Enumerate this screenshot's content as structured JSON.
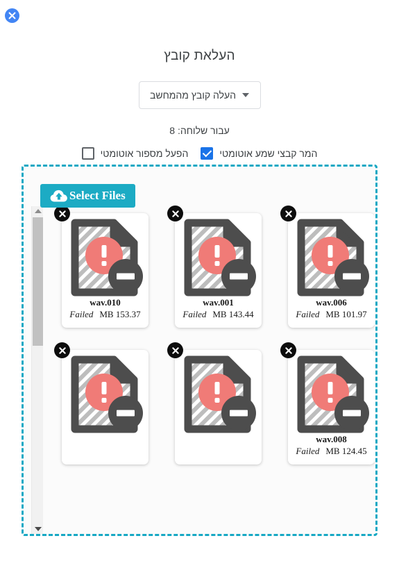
{
  "close_button": {
    "icon": "close-icon",
    "color": "#4285f4"
  },
  "header": {
    "title": "העלאת קובץ",
    "source_dropdown": {
      "label": "העלה קובץ מהמחשב",
      "caret_icon": "chevron-down-icon"
    },
    "board_line": "עבור שלוחה: 8"
  },
  "options": [
    {
      "label": "הפעל מספור אוטומטי",
      "checked": false
    },
    {
      "label": "המר קבצי שמע אוטומטי",
      "checked": true
    }
  ],
  "dropzone": {
    "select_files_label": "Select Files",
    "select_files_icon": "cloud-upload-icon",
    "border_color": "#17a8c4",
    "button_color": "#1cabc4",
    "scrollbar": {
      "up_arrow_icon": "triangle-up-icon",
      "down_arrow_icon": "triangle-down-icon"
    },
    "files": [
      {
        "name": "wav.006",
        "status": "Failed",
        "size": "MB 101.97",
        "icon": "file-error-icon",
        "remove_icon": "close-icon"
      },
      {
        "name": "wav.001",
        "status": "Failed",
        "size": "MB 143.44",
        "icon": "file-error-icon",
        "remove_icon": "close-icon"
      },
      {
        "name": "wav.010",
        "status": "Failed",
        "size": "MB 153.37",
        "icon": "file-error-icon",
        "remove_icon": "close-icon"
      },
      {
        "name": "wav.008",
        "status": "Failed",
        "size": "MB 124.45",
        "icon": "file-error-icon",
        "remove_icon": "close-icon"
      },
      {
        "name": "",
        "status": "",
        "size": "",
        "icon": "file-error-icon",
        "remove_icon": "close-icon"
      },
      {
        "name": "",
        "status": "",
        "size": "",
        "icon": "file-error-icon",
        "remove_icon": "close-icon"
      }
    ]
  },
  "colors": {
    "accent_blue": "#4285f4",
    "teal": "#1cabc4",
    "error_red": "#f07b77",
    "icon_gray": "#4d4d4d",
    "checkbox_blue": "#1a73e8"
  }
}
